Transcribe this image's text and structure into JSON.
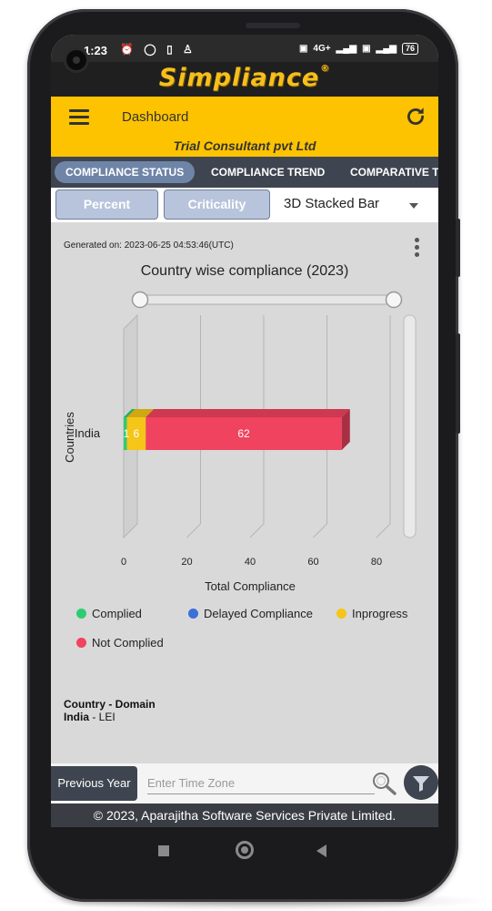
{
  "status_bar": {
    "time": "1:23",
    "network": "4G+",
    "battery": "76"
  },
  "brand": {
    "name": "Simpliance",
    "mark": "®"
  },
  "app_bar": {
    "title": "Dashboard",
    "company": "Trial Consultant pvt Ltd",
    "menu_icon": "hamburger-icon",
    "refresh_icon": "refresh-icon"
  },
  "tabs": [
    {
      "label": "COMPLIANCE STATUS",
      "active": true
    },
    {
      "label": "COMPLIANCE TREND",
      "active": false
    },
    {
      "label": "COMPARATIVE T",
      "active": false
    }
  ],
  "controls": {
    "percent_label": "Percent",
    "criticality_label": "Criticality",
    "chart_type_value": "3D Stacked Bar"
  },
  "chart_meta": {
    "generated_on": "Generated on: 2023-06-25 04:53:46(UTC)",
    "menu_icon": "kebab-menu-icon"
  },
  "chart_data": {
    "type": "bar",
    "orientation": "horizontal",
    "stacked": true,
    "three_d": true,
    "title": "Country wise compliance (2023)",
    "xlabel": "Total Compliance",
    "ylabel": "Countries",
    "categories": [
      "India"
    ],
    "xlim": [
      0,
      80
    ],
    "x_ticks": [
      "0",
      "20",
      "40",
      "60",
      "80"
    ],
    "series": [
      {
        "name": "Complied",
        "values": [
          1
        ],
        "color": "#2ecc71"
      },
      {
        "name": "Delayed Compliance",
        "values": [
          0
        ],
        "color": "#3b6fd9"
      },
      {
        "name": "Inprogress",
        "values": [
          6
        ],
        "color": "#f5c518"
      },
      {
        "name": "Not Complied",
        "values": [
          62
        ],
        "color": "#f0435f"
      }
    ],
    "data_labels": [
      "1",
      "6",
      "62"
    ],
    "legend_position": "bottom"
  },
  "domain_info": {
    "heading": "Country - Domain",
    "country": "India",
    "domain": " - LEI"
  },
  "bottom": {
    "previous_year_label": "Previous Year",
    "timezone_placeholder": "Enter Time Zone",
    "search_icon": "search-icon",
    "filter_icon": "filter-icon"
  },
  "footer": {
    "text": "© 2023, Aparajitha Software Services Private Limited."
  },
  "nav": {
    "recents": "square-icon",
    "home": "home-circle-icon",
    "back": "back-triangle-icon"
  }
}
